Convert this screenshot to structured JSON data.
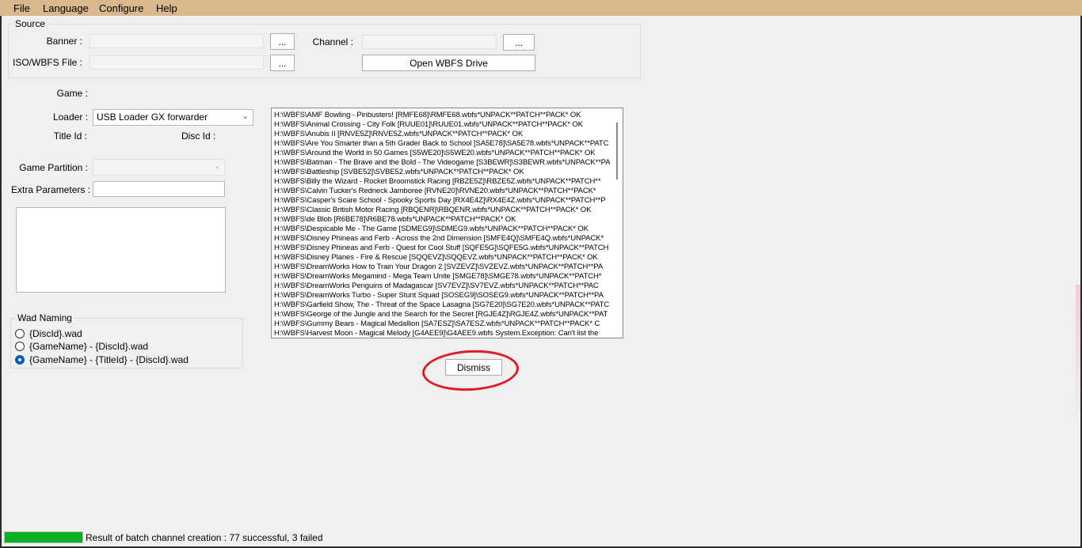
{
  "menu": {
    "file": "File",
    "language": "Language",
    "configure": "Configure",
    "help": "Help"
  },
  "source": {
    "legend": "Source",
    "banner_label": "Banner :",
    "banner_value": "",
    "banner_browse": "...",
    "iso_label": "ISO/WBFS File :",
    "iso_value": "",
    "iso_browse": "...",
    "channel_label": "Channel :",
    "channel_value": "",
    "channel_browse": "...",
    "open_drive": "Open WBFS Drive"
  },
  "game": {
    "game_label": "Game :",
    "loader_label": "Loader :",
    "loader_value": "USB Loader GX forwarder",
    "title_id_label": "Title Id :",
    "disc_id_label": "Disc Id :",
    "partition_label": "Game Partition :",
    "partition_value": "",
    "extra_label": "Extra Parameters :",
    "extra_value": "",
    "notes_value": ""
  },
  "wad_naming": {
    "legend": "Wad Naming",
    "options": [
      {
        "label": "{DiscId}.wad",
        "checked": false
      },
      {
        "label": "{GameName} - {DiscId}.wad",
        "checked": false
      },
      {
        "label": "{GameName} - {TitleId} - {DiscId}.wad",
        "checked": true
      }
    ]
  },
  "log": {
    "lines": [
      "H:\\WBFS\\AMF Bowling - Pinbusters! [RMFE68]\\RMFE68.wbfs*UNPACK**PATCH**PACK*  OK",
      "H:\\WBFS\\Animal Crossing - City Folk [RUUE01]\\RUUE01.wbfs*UNPACK**PATCH**PACK*  OK",
      "H:\\WBFS\\Anubis II [RNVE5Z]\\RNVE5Z.wbfs*UNPACK**PATCH**PACK*  OK",
      "H:\\WBFS\\Are You Smarter than a 5th Grader Back to School [SA5E78]\\SA5E78.wbfs*UNPACK**PATC",
      "H:\\WBFS\\Around the World in 50 Games [S5WE20]\\S5WE20.wbfs*UNPACK**PATCH**PACK*  OK",
      "H:\\WBFS\\Batman - The Brave and the Bold - The Videogame [S3BEWR]\\S3BEWR.wbfs*UNPACK**PA",
      "H:\\WBFS\\Battleship [SVBE52]\\SVBE52.wbfs*UNPACK**PATCH**PACK*  OK",
      "H:\\WBFS\\Billy the Wizard - Rocket Broomstick Racing [RBZE5Z]\\RBZE5Z.wbfs*UNPACK**PATCH**",
      "H:\\WBFS\\Calvin Tucker's Redneck Jamboree [RVNE20]\\RVNE20.wbfs*UNPACK**PATCH**PACK*",
      "H:\\WBFS\\Casper's Scare School - Spooky Sports Day [RX4E4Z]\\RX4E4Z.wbfs*UNPACK**PATCH**P",
      "H:\\WBFS\\Classic British Motor Racing [RBQENR]\\RBQENR.wbfs*UNPACK**PATCH**PACK*  OK",
      "H:\\WBFS\\de Blob [R6BE78]\\R6BE78.wbfs*UNPACK**PATCH**PACK*  OK",
      "H:\\WBFS\\Despicable Me - The Game [SDMEG9]\\SDMEG9.wbfs*UNPACK**PATCH**PACK*  OK",
      "H:\\WBFS\\Disney Phineas and Ferb - Across the 2nd Dimension [SMFE4Q]\\SMFE4Q.wbfs*UNPACK*",
      "H:\\WBFS\\Disney Phineas and Ferb - Quest for Cool Stuff [SQFE5G]\\SQFE5G.wbfs*UNPACK**PATCH",
      "H:\\WBFS\\Disney Planes - Fire & Rescue [SQQEVZ]\\SQQEVZ.wbfs*UNPACK**PATCH**PACK*  OK",
      "H:\\WBFS\\DreamWorks How to Train Your Dragon 2 [SVZEVZ]\\SVZEVZ.wbfs*UNPACK**PATCH**PA",
      "H:\\WBFS\\DreamWorks Megamind - Mega Team Unite [SMGE78]\\SMGE78.wbfs*UNPACK**PATCH*",
      "H:\\WBFS\\DreamWorks Penguins of Madagascar [SV7EVZ]\\SV7EVZ.wbfs*UNPACK**PATCH**PAC",
      "H:\\WBFS\\DreamWorks Turbo - Super Stunt Squad [SOSEG9]\\SOSEG9.wbfs*UNPACK**PATCH**PA",
      "H:\\WBFS\\Garfield Show, The - Threat of the Space Lasagna [SG7E20]\\SG7E20.wbfs*UNPACK**PATC",
      "H:\\WBFS\\George of the Jungle and the Search for the Secret [RGJE4Z]\\RGJE4Z.wbfs*UNPACK**PAT",
      "H:\\WBFS\\Gummy Bears - Magical Medallion [SA7ESZ]\\SA7ESZ.wbfs*UNPACK**PATCH**PACK*  C",
      "H:\\WBFS\\Harvest Moon - Magical Melody [G4AEE9]\\G4AEE9.wbfs  System.Exception: Can't list the"
    ]
  },
  "dismiss_label": "Dismiss",
  "status": {
    "text": "Result of batch channel creation : 77 successful, 3 failed",
    "progress_percent": 100,
    "progress_color": "#06b025"
  },
  "colors": {
    "menubar": "#d8b88c",
    "annotation_circle": "#e01b24",
    "radio_accent": "#005fb8"
  }
}
